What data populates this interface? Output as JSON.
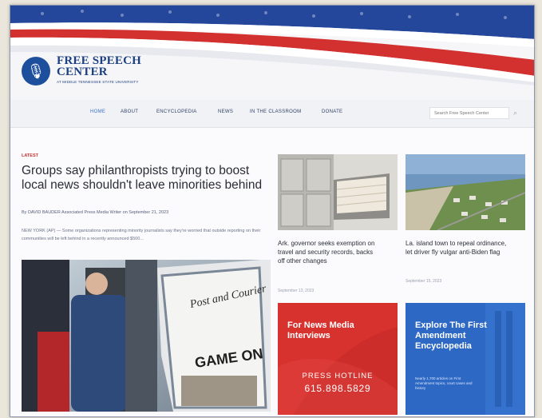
{
  "site": {
    "name": "FREE SPEECH CENTER",
    "tagline": "AT MIDDLE TENNESSEE STATE UNIVERSITY"
  },
  "nav": {
    "items": [
      "HOME",
      "ABOUT",
      "ENCYCLOPEDIA",
      "NEWS",
      "IN THE CLASSROOM",
      "DONATE"
    ],
    "active": "HOME",
    "search_placeholder": "Search Free Speech Center"
  },
  "lead": {
    "section": "LATEST",
    "headline": "Groups say philanthropists trying to boost local news shouldn't leave minorities behind",
    "byline": "By DAVID BAUDER Associated Press Media Writer on September 21, 2023",
    "excerpt": "NEW YORK (AP) — Some organizations representing minority journalists say they're worried that outside reporting on their communities will be left behind in a recently announced $500..."
  },
  "cards": [
    {
      "title": "Ark. governor seeks exemption on travel and security records, backs off other changes",
      "date": "September 13, 2023",
      "image": "filing-cabinet-photo"
    },
    {
      "title": "La. island town to repeal ordinance, let driver fly vulgar anti-Biden flag",
      "date": "September 15, 2023",
      "image": "coastal-town-aerial-photo"
    }
  ],
  "promos": {
    "media": {
      "title": "For News Media Interviews",
      "hotline_label": "PRESS HOTLINE",
      "phone": "615.898.5829"
    },
    "encyclopedia": {
      "title": "Explore The First Amendment Encyclopedia",
      "desc": "Nearly 1,700 articles on First Amendment topics, court cases and history"
    }
  },
  "colors": {
    "brand_blue": "#1e4f9c",
    "flag_red": "#d2312f",
    "promo_red": "#d8322f",
    "promo_blue": "#2d68c4"
  },
  "lead_photo": {
    "newspaper_masthead": "Post and Courier",
    "newspaper_headline": "GAME ON"
  }
}
